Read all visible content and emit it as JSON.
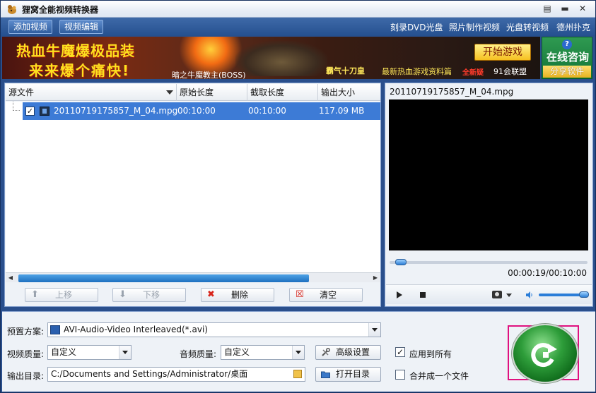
{
  "app": {
    "title": "狸窝全能视频转换器",
    "colors": {
      "accent": "#3d7bd6",
      "title_bar": "#e8eef6",
      "frame": "#2a4f8c",
      "highlight": "#e0117f"
    }
  },
  "window_controls": {
    "restore": "▤",
    "minimize": "▬",
    "close": "✕"
  },
  "toolbar": {
    "add_video": "添加视频",
    "edit_video": "视频编辑"
  },
  "top_links": [
    "刻录DVD光盘",
    "照片制作视频",
    "光盘转视频",
    "德州扑克"
  ],
  "banner": {
    "slogan_line1": "热血牛魔爆极品装",
    "slogan_line2": "来来爆个痛快!",
    "boss_caption": "暗之牛魔教主(BOSS)",
    "blade_caption": "霸气十刀皇",
    "news_link": "最新热血游戏资料篇",
    "new_badge": "全新疑",
    "union_label": "91会联盟",
    "start_game": "开始游戏"
  },
  "consult": {
    "help_icon": "?",
    "label": "在线咨询",
    "share": "分享软件"
  },
  "file_list": {
    "columns": [
      "源文件",
      "原始长度",
      "截取长度",
      "输出大小"
    ],
    "rows": [
      {
        "name": "20110719175857_M_04.mpg",
        "original_length": "00:10:00",
        "clip_length": "00:10:00",
        "output_size": "117.09 MB",
        "checked": true
      }
    ],
    "buttons": {
      "move_up": "上移",
      "move_down": "下移",
      "delete": "删除",
      "clear": "清空"
    }
  },
  "preview": {
    "file_name": "20110719175857_M_04.mpg",
    "time": "00:00:19/00:10:00",
    "seek_fraction": 0.03,
    "volume_fraction": 1.0
  },
  "settings": {
    "preset_label": "预置方案:",
    "preset_value": "AVI-Audio-Video Interleaved(*.avi)",
    "video_quality_label": "视频质量:",
    "video_quality_value": "自定义",
    "audio_quality_label": "音频质量:",
    "audio_quality_value": "自定义",
    "advanced_button": "高级设置",
    "apply_all_label": "应用到所有",
    "apply_all_checked": true,
    "output_dir_label": "输出目录:",
    "output_dir_value": "C:/Documents and Settings/Administrator/桌面",
    "open_dir_button": "打开目录",
    "merge_label": "合并成一个文件",
    "merge_checked": false
  }
}
